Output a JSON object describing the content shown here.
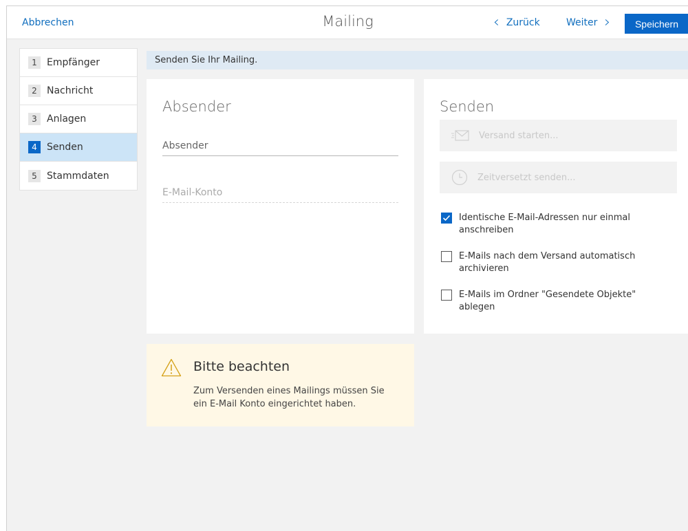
{
  "header": {
    "cancel_label": "Abbrechen",
    "title": "Mailing",
    "back_label": "Zurück",
    "next_label": "Weiter",
    "save_label": "Speichern"
  },
  "steps": [
    {
      "num": "1",
      "label": "Empfänger",
      "active": false
    },
    {
      "num": "2",
      "label": "Nachricht",
      "active": false
    },
    {
      "num": "3",
      "label": "Anlagen",
      "active": false
    },
    {
      "num": "4",
      "label": "Senden",
      "active": true
    },
    {
      "num": "5",
      "label": "Stammdaten",
      "active": false
    }
  ],
  "info_bar": "Senden Sie Ihr Mailing.",
  "sender_card": {
    "title": "Absender",
    "sender_field": "Absender",
    "account_field": "E-Mail-Konto"
  },
  "send_card": {
    "title": "Senden",
    "start_label": "Versand starten...",
    "delayed_label": "Zeitversetzt senden...",
    "options": [
      {
        "line1": "Identische E-Mail-Adressen nur einmal",
        "line2": "anschreiben",
        "checked": true
      },
      {
        "line1": "E-Mails nach dem Versand automatisch",
        "line2": "archivieren",
        "checked": false
      },
      {
        "line1": "E-Mails im Ordner \"Gesendete Objekte\"",
        "line2": "ablegen",
        "checked": false
      }
    ]
  },
  "warning": {
    "title": "Bitte beachten",
    "text_line1": "Zum Versenden eines Mailings müssen Sie",
    "text_line2": "ein E-Mail Konto eingerichtet haben."
  },
  "colors": {
    "accent": "#0a67c7",
    "link": "#106ebe",
    "active_step": "#cce4f7",
    "warning_bg": "#fff8e6",
    "info_bg": "#dfeaf4"
  }
}
